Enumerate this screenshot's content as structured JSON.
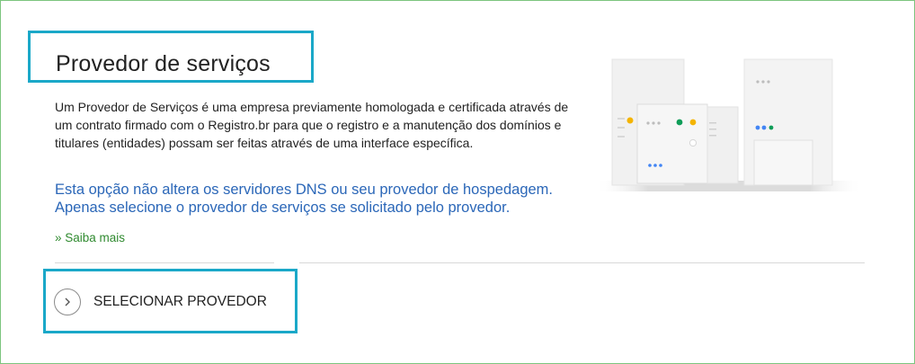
{
  "section": {
    "title": "Provedor de serviços",
    "description": "Um Provedor de Serviços é uma empresa previamente homologada e certificada através de um contrato firmado com o Registro.br para que o registro e a manutenção dos domínios e titulares (entidades) possam ser feitas através de uma interface específica.",
    "notice": "Esta opção não altera os servidores DNS ou seu provedor de hospedagem. Apenas selecione o provedor de serviços se solicitado pelo provedor.",
    "more_link": "» Saiba mais",
    "select_button": "SELECIONAR PROVEDOR"
  },
  "icons": {
    "select_button_icon": "chevron-right-icon",
    "illustration": "servers-illustration"
  },
  "colors": {
    "frame_border": "#7cc57f",
    "highlight_box": "#1aa8c8",
    "notice_text": "#2b67b8",
    "link_text": "#2f8a2f",
    "dot_yellow": "#f4b400",
    "dot_green": "#0f9d58",
    "dot_blue": "#4285f4"
  }
}
